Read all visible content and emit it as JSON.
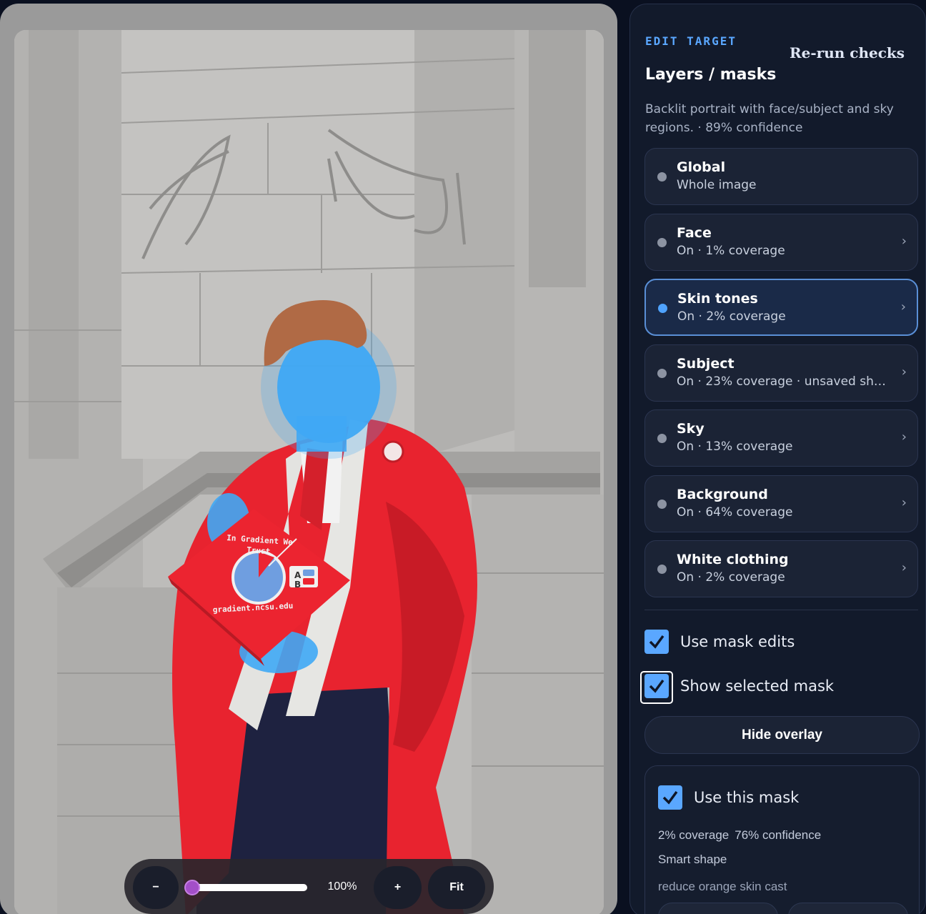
{
  "canvas": {
    "zoom": {
      "minus_label": "−",
      "plus_label": "+",
      "fit_label": "Fit",
      "value_label": "100%",
      "level": 0.0
    },
    "cap": {
      "motto_line1": "In Gradient We",
      "motto_line2": "Trust",
      "url": "gradient.ncsu.edu",
      "letter_a": "A",
      "letter_b": "B"
    }
  },
  "panel": {
    "eyebrow": "EDIT TARGET",
    "rerun_label": "Re-run checks",
    "title": "Layers / masks",
    "description": "Backlit portrait with face/subject and sky regions. · 89% confidence",
    "layers": [
      {
        "name": "Global",
        "sub": "Whole image",
        "chevron": ""
      },
      {
        "name": "Face",
        "sub": "On · 1% coverage",
        "chevron": "›"
      },
      {
        "name": "Skin tones",
        "sub": "On · 2% coverage",
        "chevron": "›"
      },
      {
        "name": "Subject",
        "sub": "On · 23% coverage · unsaved sh…",
        "chevron": "›"
      },
      {
        "name": "Sky",
        "sub": "On · 13% coverage",
        "chevron": "›"
      },
      {
        "name": "Background",
        "sub": "On · 64% coverage",
        "chevron": "›"
      },
      {
        "name": "White clothing",
        "sub": "On · 2% coverage",
        "chevron": "›"
      }
    ],
    "selected_layer": "Skin tones",
    "use_mask_edits_label": "Use mask edits",
    "use_mask_edits_checked": true,
    "show_selected_mask_label": "Show selected mask",
    "show_selected_mask_checked": true,
    "hide_overlay_label": "Hide overlay",
    "mask_detail": {
      "use_this_mask_label": "Use this mask",
      "use_this_mask_checked": true,
      "coverage": "2% coverage",
      "confidence": "76% confidence",
      "shape": "Smart shape",
      "note": "reduce orange skin cast"
    }
  },
  "colors": {
    "accent": "#5aa7ff",
    "mask_overlay": "#3fa9f5",
    "gown": "#e8232f",
    "slider_thumb": "#a34fc8"
  }
}
